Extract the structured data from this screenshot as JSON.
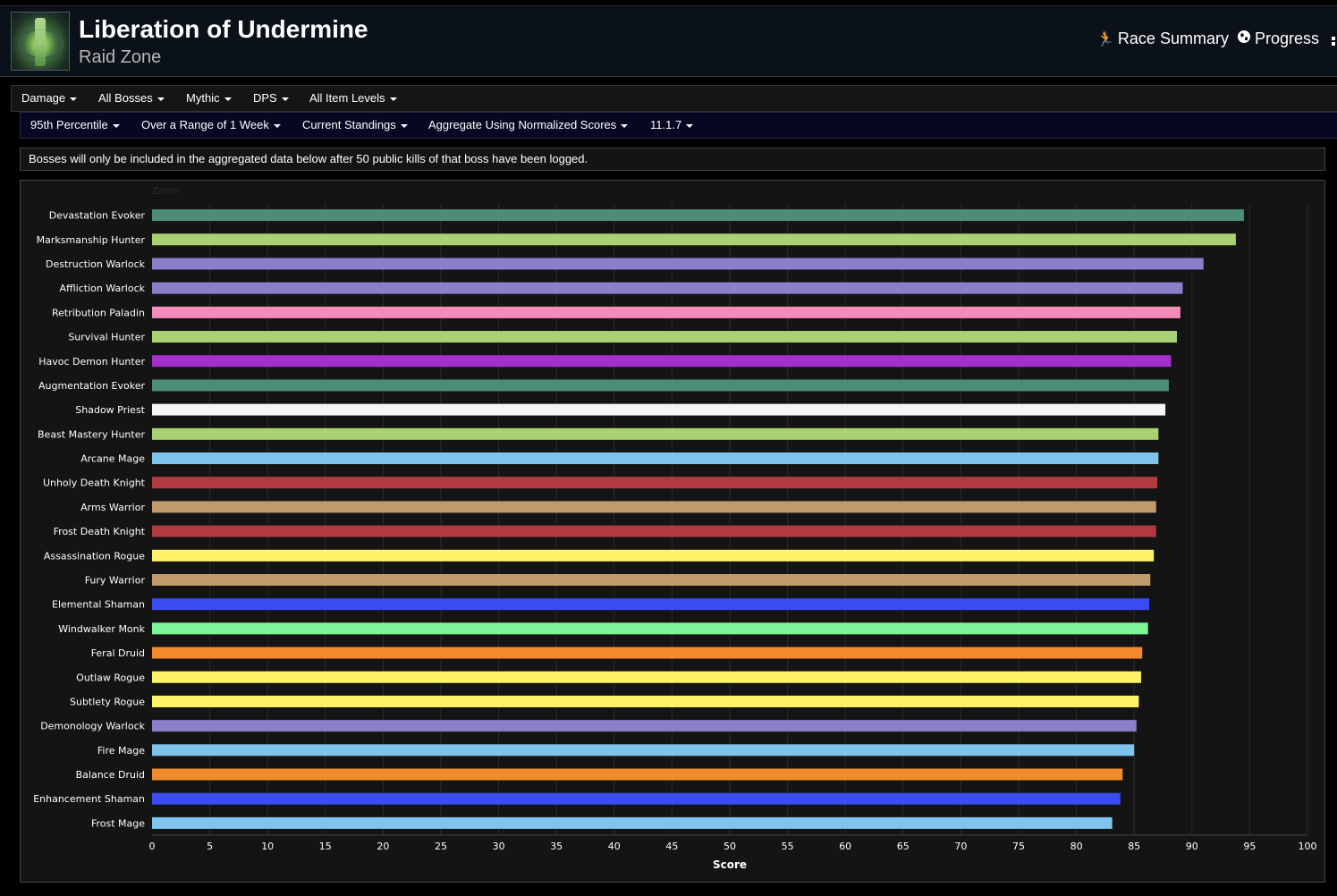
{
  "header": {
    "title": "Liberation of Undermine",
    "subtitle": "Raid Zone",
    "race_summary": "Race Summary",
    "progress": "Progress"
  },
  "filters": {
    "row1": [
      "Damage",
      "All Bosses",
      "Mythic",
      "DPS",
      "All Item Levels"
    ],
    "row2": [
      "95th Percentile",
      "Over a Range of 1 Week",
      "Current Standings",
      "Aggregate Using Normalized Scores",
      "11.1.7"
    ]
  },
  "notice": "Bosses will only be included in the aggregated data below after 50 public kills of that boss have been logged.",
  "chart_data": {
    "type": "bar",
    "orientation": "horizontal",
    "zoom_label": "Zoom",
    "xlabel": "Score",
    "xlim": [
      0,
      100
    ],
    "xticks": [
      0,
      5,
      10,
      15,
      20,
      25,
      30,
      35,
      40,
      45,
      50,
      55,
      60,
      65,
      70,
      75,
      80,
      85,
      90,
      95,
      100
    ],
    "grid": "vertical",
    "bars": [
      {
        "label": "Devastation Evoker",
        "value": 94.5,
        "color": "#4e8c7a"
      },
      {
        "label": "Marksmanship Hunter",
        "value": 93.8,
        "color": "#a9d272"
      },
      {
        "label": "Destruction Warlock",
        "value": 91.0,
        "color": "#8b7fc9"
      },
      {
        "label": "Affliction Warlock",
        "value": 89.2,
        "color": "#8b7fc9"
      },
      {
        "label": "Retribution Paladin",
        "value": 89.0,
        "color": "#f48cba"
      },
      {
        "label": "Survival Hunter",
        "value": 88.7,
        "color": "#a9d272"
      },
      {
        "label": "Havoc Demon Hunter",
        "value": 88.2,
        "color": "#a330c9"
      },
      {
        "label": "Augmentation Evoker",
        "value": 88.0,
        "color": "#4e8c7a"
      },
      {
        "label": "Shadow Priest",
        "value": 87.7,
        "color": "#f5f5f5"
      },
      {
        "label": "Beast Mastery Hunter",
        "value": 87.1,
        "color": "#a9d272"
      },
      {
        "label": "Arcane Mage",
        "value": 87.1,
        "color": "#7fc4ec"
      },
      {
        "label": "Unholy Death Knight",
        "value": 87.0,
        "color": "#b03a3e"
      },
      {
        "label": "Arms Warrior",
        "value": 86.9,
        "color": "#c09a6b"
      },
      {
        "label": "Frost Death Knight",
        "value": 86.9,
        "color": "#b03a3e"
      },
      {
        "label": "Assassination Rogue",
        "value": 86.7,
        "color": "#fff468"
      },
      {
        "label": "Fury Warrior",
        "value": 86.4,
        "color": "#c09a6b"
      },
      {
        "label": "Elemental Shaman",
        "value": 86.3,
        "color": "#3a4cf2"
      },
      {
        "label": "Windwalker Monk",
        "value": 86.2,
        "color": "#7cf598"
      },
      {
        "label": "Feral Druid",
        "value": 85.7,
        "color": "#f08a2c"
      },
      {
        "label": "Outlaw Rogue",
        "value": 85.6,
        "color": "#fff468"
      },
      {
        "label": "Subtlety Rogue",
        "value": 85.4,
        "color": "#fff468"
      },
      {
        "label": "Demonology Warlock",
        "value": 85.2,
        "color": "#8b7fc9"
      },
      {
        "label": "Fire Mage",
        "value": 85.0,
        "color": "#7fc4ec"
      },
      {
        "label": "Balance Druid",
        "value": 84.0,
        "color": "#f08a2c"
      },
      {
        "label": "Enhancement Shaman",
        "value": 83.8,
        "color": "#3a4cf2"
      },
      {
        "label": "Frost Mage",
        "value": 83.1,
        "color": "#7fc4ec"
      }
    ]
  }
}
